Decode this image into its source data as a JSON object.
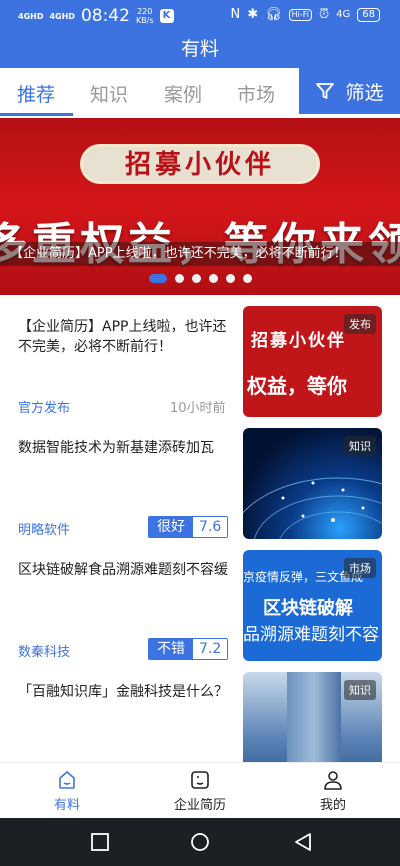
{
  "status_bar": {
    "signal1": "4GHD",
    "signal2": "4GHD",
    "time": "08:42",
    "speed_value": "220",
    "speed_unit": "KB/s",
    "k_badge": "K",
    "hifi": "Hi-Fi",
    "network": "4G",
    "battery": "68"
  },
  "app_title": "有料",
  "tabs": [
    {
      "label": "推荐",
      "active": true
    },
    {
      "label": "知识",
      "active": false
    },
    {
      "label": "案例",
      "active": false
    },
    {
      "label": "市场",
      "active": false
    }
  ],
  "filter_label": "筛选",
  "banner": {
    "heading": "招募小伙伴",
    "big_text": "多重权益，等你来领",
    "caption": "【企业简历】APP上线啦，也许还不完美，必将不断前行！",
    "dot_count": 6,
    "active_dot": 1
  },
  "cards": [
    {
      "title": "【企业简历】APP上线啦，也许还不完美，必将不断前行！",
      "source": "官方发布",
      "time": "10小时前",
      "tag": "发布",
      "thumb_text1": "招募小伙伴",
      "thumb_text2": "权益，等你"
    },
    {
      "title": "数据智能技术为新基建添砖加瓦",
      "source": "明略软件",
      "rating_label": "很好",
      "rating_score": "7.6",
      "tag": "知识"
    },
    {
      "title": "区块链破解食品溯源难题刻不容缓",
      "source": "数秦科技",
      "rating_label": "不错",
      "rating_score": "7.2",
      "tag": "市场",
      "thumb_top": "京疫情反弹，三文鱼成",
      "thumb_mid": "区块链破解",
      "thumb_bot": "品溯源难题刻不容"
    },
    {
      "title": "「百融知识库」金融科技是什么？",
      "tag": "知识"
    }
  ],
  "bottom_nav": [
    {
      "label": "有料",
      "active": true,
      "icon": "home-icon"
    },
    {
      "label": "企业简历",
      "active": false,
      "icon": "resume-icon"
    },
    {
      "label": "我的",
      "active": false,
      "icon": "profile-icon"
    }
  ],
  "colors": {
    "primary": "#3d73e0",
    "banner_red": "#c0161a"
  }
}
